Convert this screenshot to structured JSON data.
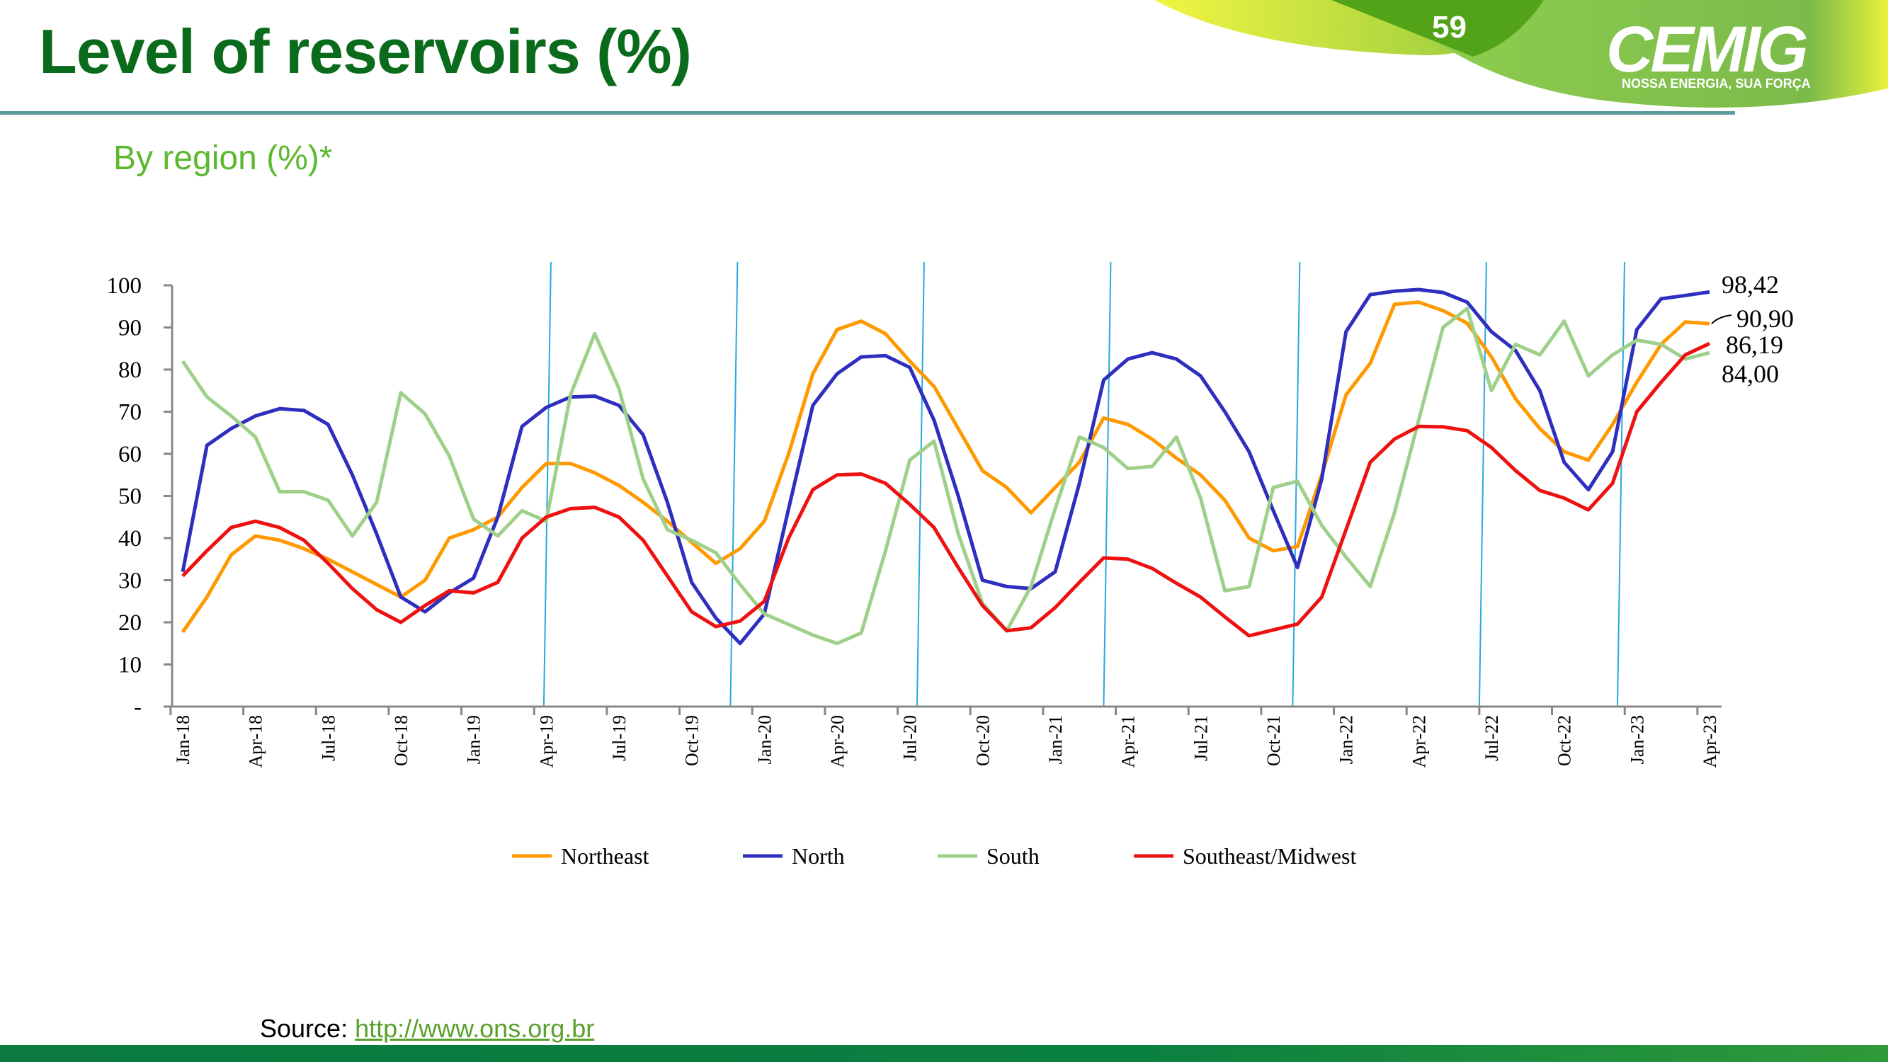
{
  "header": {
    "title": "Level of reservoirs (%)",
    "subtitle": "By region (%)*",
    "page_number": "59",
    "logo_text": "CEMIG",
    "logo_tagline": "NOSSA ENERGIA, SUA FORÇA"
  },
  "footer": {
    "source_label": "Source:",
    "source_link": "http://www.ons.org.br"
  },
  "colors": {
    "title": "#0b6b1c",
    "subtitle": "#5cb82e",
    "Northeast": "#ff9900",
    "North": "#2e2ebf",
    "South": "#9fd08a",
    "Southeast/Midwest": "#ee1111",
    "marker_lines": "#29a8e0"
  },
  "chart_data": {
    "type": "line",
    "title": "",
    "xlabel": "",
    "ylabel": "",
    "ylim": [
      0,
      100
    ],
    "yticks": [
      "-",
      "10",
      "20",
      "30",
      "40",
      "50",
      "60",
      "70",
      "80",
      "90",
      "100"
    ],
    "grid": false,
    "legend": "bottom",
    "x": [
      "Jan-18",
      "Feb-18",
      "Mar-18",
      "Apr-18",
      "May-18",
      "Jun-18",
      "Jul-18",
      "Aug-18",
      "Sep-18",
      "Oct-18",
      "Nov-18",
      "Dec-18",
      "Jan-19",
      "Feb-19",
      "Mar-19",
      "Apr-19",
      "May-19",
      "Jun-19",
      "Jul-19",
      "Aug-19",
      "Sep-19",
      "Oct-19",
      "Nov-19",
      "Dec-19",
      "Jan-20",
      "Feb-20",
      "Mar-20",
      "Apr-20",
      "May-20",
      "Jun-20",
      "Jul-20",
      "Aug-20",
      "Sep-20",
      "Oct-20",
      "Nov-20",
      "Dec-20",
      "Jan-21",
      "Feb-21",
      "Mar-21",
      "Apr-21",
      "May-21",
      "Jun-21",
      "Jul-21",
      "Aug-21",
      "Sep-21",
      "Oct-21",
      "Nov-21",
      "Dec-21",
      "Jan-22",
      "Feb-22",
      "Mar-22",
      "Apr-22",
      "May-22",
      "Jun-22",
      "Jul-22",
      "Aug-22",
      "Sep-22",
      "Oct-22",
      "Nov-22",
      "Dec-22",
      "Jan-23",
      "Feb-23",
      "Mar-23",
      "Apr-23"
    ],
    "xtick_labels": [
      "Jan-18",
      "Apr-18",
      "Jul-18",
      "Oct-18",
      "Jan-19",
      "Apr-19",
      "Jul-19",
      "Oct-19",
      "Jan-20",
      "Apr-20",
      "Jul-20",
      "Oct-20",
      "Jan-21",
      "Apr-21",
      "Jul-21",
      "Oct-21",
      "Jan-22",
      "Apr-22",
      "Jul-22",
      "Oct-22",
      "Jan-23",
      "Apr-23"
    ],
    "vertical_markers_month_index": [
      14.9,
      22.6,
      30.3,
      38.0,
      45.8,
      53.5,
      59.2
    ],
    "series": [
      {
        "name": "Northeast",
        "end_label": "90,90",
        "values": [
          17.7,
          26,
          36,
          40.5,
          39.5,
          37.5,
          35,
          32,
          29,
          26,
          30,
          40,
          42,
          45,
          52,
          57.7,
          57.7,
          55.5,
          52.5,
          48.5,
          44,
          39,
          34,
          37.5,
          44,
          60,
          79,
          89.5,
          91.5,
          88.5,
          82,
          76,
          66,
          56,
          52,
          46,
          52,
          58,
          68.5,
          67,
          63.5,
          59,
          55,
          49,
          40,
          37,
          38,
          55,
          74,
          81.5,
          95.5,
          96,
          94,
          91,
          83,
          73,
          66,
          60.5,
          58.5,
          67,
          77,
          86,
          91.3,
          90.9
        ]
      },
      {
        "name": "North",
        "end_label": "98,42",
        "values": [
          32,
          62,
          66,
          69,
          70.7,
          70.3,
          67,
          55,
          41,
          26,
          22.5,
          27,
          30.5,
          45,
          66.5,
          71,
          73.5,
          73.7,
          71.5,
          64.5,
          48.5,
          29.5,
          21,
          15,
          22,
          47,
          71.5,
          79,
          83,
          83.3,
          80.5,
          68,
          50,
          30,
          28.5,
          28,
          32,
          53,
          77.5,
          82.5,
          84,
          82.5,
          78.5,
          70,
          60.5,
          46.5,
          33,
          54,
          89,
          97.8,
          98.6,
          99,
          98.3,
          96,
          89,
          84.5,
          75,
          58,
          51.5,
          60.5,
          89.5,
          96.8,
          97.6,
          98.42
        ]
      },
      {
        "name": "South",
        "end_label": "84,00",
        "values": [
          82,
          73.5,
          69,
          64,
          51,
          51,
          49,
          40.5,
          48.5,
          74.5,
          69.5,
          59.5,
          44.5,
          40.5,
          46.5,
          44,
          74,
          88.5,
          75.5,
          54,
          42,
          39.5,
          36.5,
          29,
          22,
          19.5,
          17,
          15,
          17.5,
          37,
          58.5,
          63,
          41,
          24.5,
          18,
          28.5,
          47,
          64,
          61.5,
          56.5,
          57,
          64,
          49.5,
          27.5,
          28.5,
          52,
          53.5,
          43,
          35.5,
          28.5,
          46,
          68,
          90,
          94.5,
          75,
          86,
          83.5,
          91.5,
          78.5,
          83.5,
          87,
          86,
          82.5,
          84.0
        ]
      },
      {
        "name": "Southeast/Midwest",
        "end_label": "86,19",
        "values": [
          31,
          37,
          42.5,
          44,
          42.5,
          39.5,
          34,
          28,
          23,
          20,
          24,
          27.5,
          27,
          29.5,
          40,
          45,
          47,
          47.3,
          45,
          39.5,
          31,
          22.5,
          19,
          20.3,
          25,
          40,
          51.5,
          55,
          55.2,
          53,
          48,
          42.5,
          33,
          24,
          18,
          18.7,
          23.5,
          29.5,
          35.3,
          35,
          32.8,
          29.3,
          26,
          21.3,
          16.8,
          18.2,
          19.6,
          26,
          42,
          58,
          63.5,
          66.5,
          66.4,
          65.5,
          61.5,
          56,
          51.3,
          49.5,
          46.7,
          53,
          70,
          77,
          83.5,
          86.19
        ]
      }
    ]
  }
}
